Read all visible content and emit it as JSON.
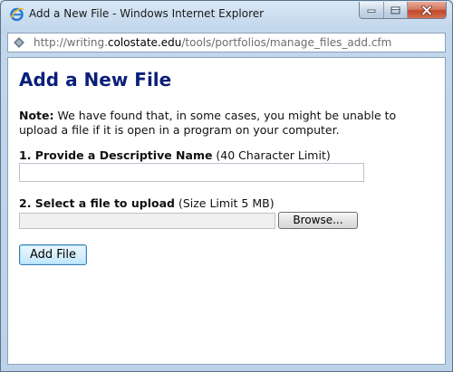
{
  "window": {
    "title": "Add a New File - Windows Internet Explorer"
  },
  "address_bar": {
    "url_prefix": "http://writing.",
    "url_domain": "colostate.edu",
    "url_path": "/tools/portfolios/manage_files_add.cfm"
  },
  "page": {
    "title": "Add a New File",
    "note_label": "Note:",
    "note_text": " We have found that, in some cases, you might be unable to upload a file if it is open in a program on your computer.",
    "name_field": {
      "label": "1. Provide a Descriptive Name",
      "hint": " (40 Character Limit)",
      "value": ""
    },
    "file_field": {
      "label": "2. Select a file to upload",
      "hint": " (Size Limit 5 MB)",
      "value": "",
      "browse_label": "Browse..."
    },
    "submit_label": "Add File"
  },
  "colors": {
    "title_blue": "#0b1f7a",
    "close_red": "#c2462c"
  },
  "icons": [
    "ie-logo-icon",
    "minimize-icon",
    "maximize-icon",
    "close-icon",
    "page-icon"
  ]
}
